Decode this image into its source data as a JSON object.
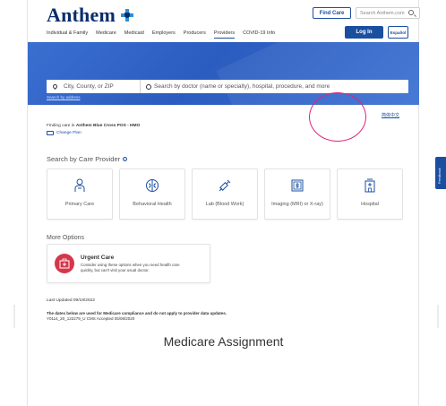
{
  "header": {
    "logo_text": "Anthem",
    "logo_mark": "cross-shield-icon",
    "find_care": "Find Care",
    "search_placeholder": "Search Anthem.com",
    "login": "Log In",
    "espanol": "Español",
    "nav": [
      "Individual & Family",
      "Medicare",
      "Medicaid",
      "Employers",
      "Producers",
      "Providers",
      "COVID-19 Info"
    ],
    "active_nav": "Providers"
  },
  "hero": {
    "location_placeholder": "City, County, or ZIP",
    "provider_placeholder": "Search by doctor (name or specialty), hospital, procedure, and more",
    "search_by_address": "Search by address"
  },
  "language_link": "简体中文",
  "plan": {
    "prefix": "Finding care in",
    "name": "Anthem Blue Cross POS - HMO",
    "change": "Change Plan"
  },
  "care_provider": {
    "heading": "Search by Care Provider",
    "tiles": [
      {
        "label": "Primary Care",
        "icon": "doctor-icon"
      },
      {
        "label": "Behavioral Health",
        "icon": "brain-icon"
      },
      {
        "label": "Lab (Blood Work)",
        "icon": "syringe-icon"
      },
      {
        "label": "Imaging (MRI) or X-ray)",
        "icon": "xray-icon"
      },
      {
        "label": "Hospital",
        "icon": "hospital-icon"
      }
    ]
  },
  "more_options": {
    "heading": "More Options",
    "urgent_title": "Urgent Care",
    "urgent_desc": "Consider using these options when you need health care quickly, but can't visit your usual doctor."
  },
  "footer": {
    "last_updated": "Last Updated 09/19/2022",
    "disclaimer_bold": "The dates below are used for Medicare compliance and do not apply to provider data updates.",
    "disclaimer_code": "Y0114_20_122279_U CMS Accepted 05/08/2020",
    "medicare_heading": "Medicare Assignment"
  },
  "feedback": "Feedback",
  "colors": {
    "brand": "#1a4fa0",
    "hero": "#2b5cbf",
    "annotation": "#e0237a",
    "urgent": "#d4374c"
  }
}
